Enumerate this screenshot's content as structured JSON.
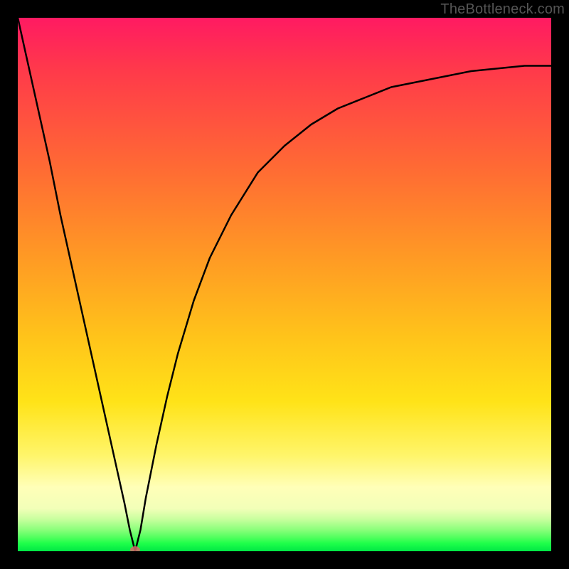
{
  "watermark": "TheBottleneck.com",
  "chart_data": {
    "type": "line",
    "title": "",
    "xlabel": "",
    "ylabel": "",
    "xlim": [
      0,
      100
    ],
    "ylim": [
      0,
      100
    ],
    "grid": false,
    "legend": false,
    "background_gradient": {
      "direction": "vertical",
      "stops": [
        {
          "pos": 0,
          "color": "#ff1a62"
        },
        {
          "pos": 28,
          "color": "#ff6a34"
        },
        {
          "pos": 60,
          "color": "#ffc41a"
        },
        {
          "pos": 82,
          "color": "#fff56a"
        },
        {
          "pos": 92,
          "color": "#f2ffb8"
        },
        {
          "pos": 100,
          "color": "#00e845"
        }
      ]
    },
    "series": [
      {
        "name": "bottleneck-curve",
        "color": "#000000",
        "x": [
          0,
          2,
          4,
          6,
          8,
          10,
          12,
          14,
          16,
          18,
          20,
          21,
          22,
          23,
          24,
          26,
          28,
          30,
          33,
          36,
          40,
          45,
          50,
          55,
          60,
          65,
          70,
          75,
          80,
          85,
          90,
          95,
          100
        ],
        "y": [
          100,
          91,
          82,
          73,
          63,
          54,
          45,
          36,
          27,
          18,
          9,
          4,
          0,
          4,
          10,
          20,
          29,
          37,
          47,
          55,
          63,
          71,
          76,
          80,
          83,
          85,
          87,
          88,
          89,
          90,
          90.5,
          91,
          91
        ]
      }
    ],
    "markers": [
      {
        "name": "minimum-point",
        "x": 22,
        "y": 0,
        "color": "#d46a6a",
        "size": 8
      }
    ]
  }
}
